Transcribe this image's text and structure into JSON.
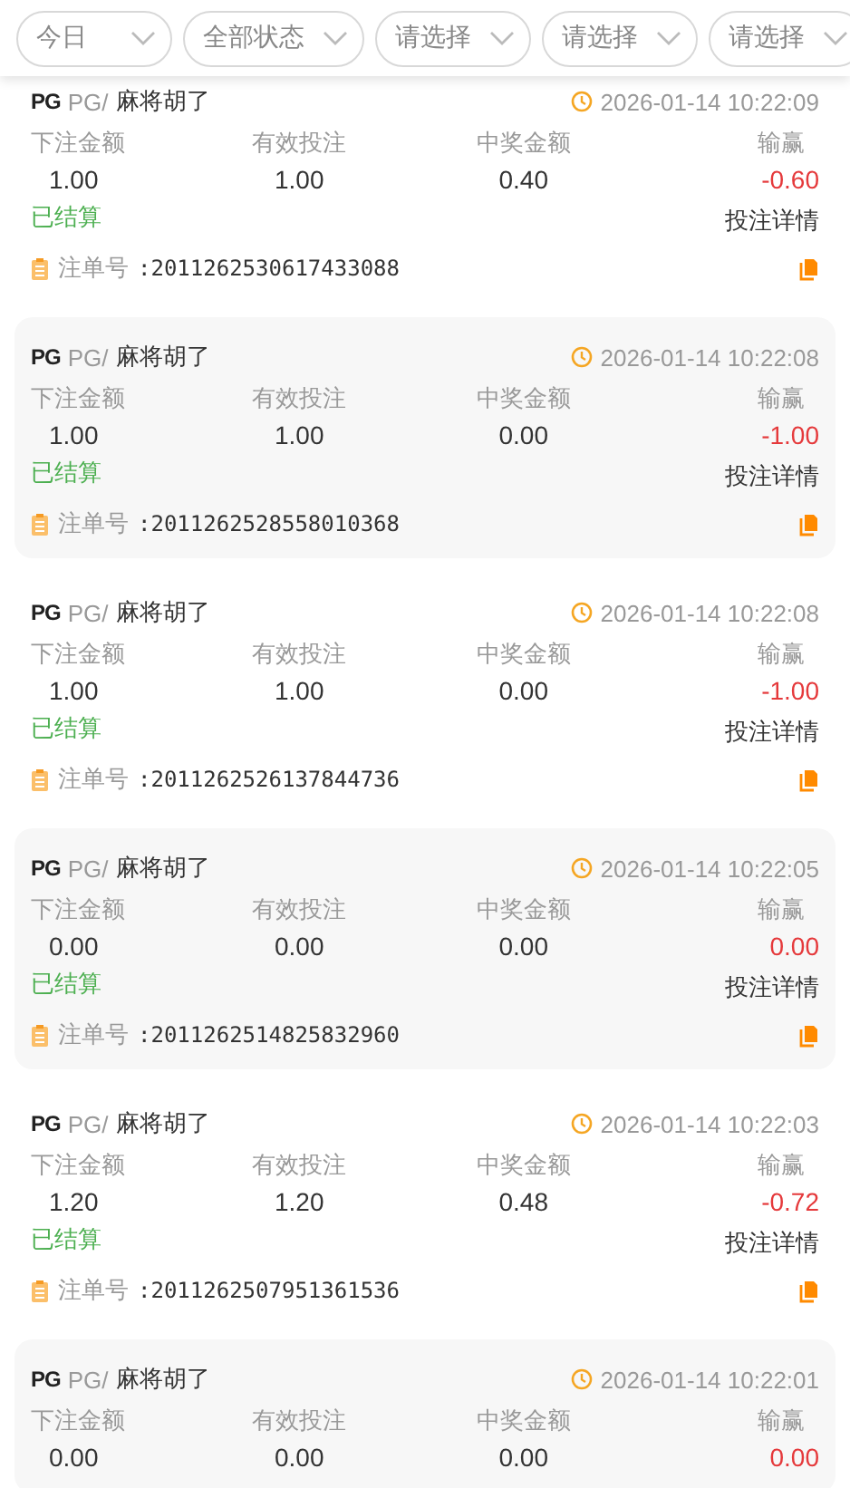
{
  "filters": [
    {
      "label": "今日"
    },
    {
      "label": "全部状态"
    },
    {
      "label": "请选择"
    },
    {
      "label": "请选择"
    },
    {
      "label": "请选择"
    }
  ],
  "bets": [
    {
      "logo": "PG",
      "provider": "PG/",
      "game": "麻将胡了",
      "time": "2026-01-14 10:22:09",
      "labels": [
        "下注金额",
        "有效投注",
        "中奖金额",
        "输赢"
      ],
      "bet": "1.00",
      "valid": "1.00",
      "win": "0.40",
      "result": "-0.60",
      "loss": true,
      "status": "已结算",
      "detail": "投注详情",
      "order_label": "注单号",
      "order_no": ":2011262530617433088"
    },
    {
      "logo": "PG",
      "provider": "PG/",
      "game": "麻将胡了",
      "time": "2026-01-14 10:22:08",
      "labels": [
        "下注金额",
        "有效投注",
        "中奖金额",
        "输赢"
      ],
      "bet": "1.00",
      "valid": "1.00",
      "win": "0.00",
      "result": "-1.00",
      "loss": true,
      "status": "已结算",
      "detail": "投注详情",
      "order_label": "注单号",
      "order_no": ":2011262528558010368"
    },
    {
      "logo": "PG",
      "provider": "PG/",
      "game": "麻将胡了",
      "time": "2026-01-14 10:22:08",
      "labels": [
        "下注金额",
        "有效投注",
        "中奖金额",
        "输赢"
      ],
      "bet": "1.00",
      "valid": "1.00",
      "win": "0.00",
      "result": "-1.00",
      "loss": true,
      "status": "已结算",
      "detail": "投注详情",
      "order_label": "注单号",
      "order_no": ":2011262526137844736"
    },
    {
      "logo": "PG",
      "provider": "PG/",
      "game": "麻将胡了",
      "time": "2026-01-14 10:22:05",
      "labels": [
        "下注金额",
        "有效投注",
        "中奖金额",
        "输赢"
      ],
      "bet": "0.00",
      "valid": "0.00",
      "win": "0.00",
      "result": "0.00",
      "loss": true,
      "status": "已结算",
      "detail": "投注详情",
      "order_label": "注单号",
      "order_no": ":2011262514825832960"
    },
    {
      "logo": "PG",
      "provider": "PG/",
      "game": "麻将胡了",
      "time": "2026-01-14 10:22:03",
      "labels": [
        "下注金额",
        "有效投注",
        "中奖金额",
        "输赢"
      ],
      "bet": "1.20",
      "valid": "1.20",
      "win": "0.48",
      "result": "-0.72",
      "loss": true,
      "status": "已结算",
      "detail": "投注详情",
      "order_label": "注单号",
      "order_no": ":2011262507951361536"
    },
    {
      "logo": "PG",
      "provider": "PG/",
      "game": "麻将胡了",
      "time": "2026-01-14 10:22:01",
      "labels": [
        "下注金额",
        "有效投注",
        "中奖金额",
        "输赢"
      ],
      "bet": "0.00",
      "valid": "0.00",
      "win": "0.00",
      "result": "0.00",
      "loss": true
    }
  ]
}
